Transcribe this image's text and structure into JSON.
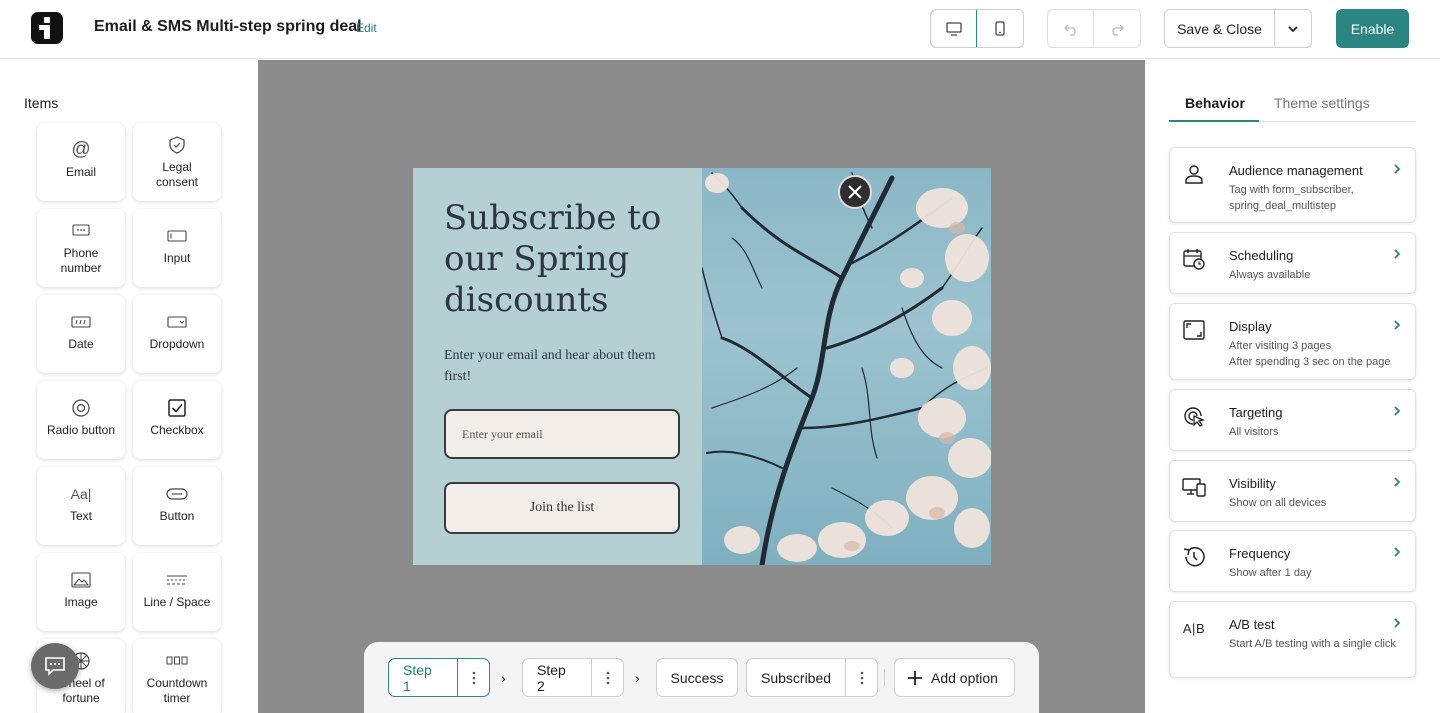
{
  "header": {
    "title": "Email & SMS Multi-step spring deal",
    "edit_label": "Edit",
    "save_label": "Save & Close",
    "enable_label": "Enable"
  },
  "sidebar": {
    "title": "Items",
    "items": [
      {
        "label": "Email",
        "icon": "at-icon"
      },
      {
        "label": "Legal\nconsent",
        "icon": "shield-icon"
      },
      {
        "label": "Phone\nnumber",
        "icon": "phone-icon"
      },
      {
        "label": "Input",
        "icon": "input-icon"
      },
      {
        "label": "Date",
        "icon": "date-icon"
      },
      {
        "label": "Dropdown",
        "icon": "dropdown-icon"
      },
      {
        "label": "Radio button",
        "icon": "radio-icon"
      },
      {
        "label": "Checkbox",
        "icon": "checkbox-icon"
      },
      {
        "label": "Text",
        "icon": "text-icon"
      },
      {
        "label": "Button",
        "icon": "button-icon"
      },
      {
        "label": "Image",
        "icon": "image-icon"
      },
      {
        "label": "Line / Space",
        "icon": "line-icon"
      },
      {
        "label": "Wheel of\nfortune",
        "icon": "wheel-icon"
      },
      {
        "label": "Countdown\ntimer",
        "icon": "timer-icon"
      }
    ]
  },
  "popup": {
    "heading": "Subscribe to our Spring discounts",
    "subtext": "Enter your email and hear about them first!",
    "email_placeholder": "Enter your email",
    "cta": "Join the list"
  },
  "steps": {
    "items": [
      {
        "label": "Step 1",
        "active": true,
        "has_menu": true
      },
      {
        "label": "Step 2",
        "active": false,
        "has_menu": true
      },
      {
        "label": "Success",
        "active": false,
        "has_menu": false
      },
      {
        "label": "Subscribed",
        "active": false,
        "has_menu": true
      }
    ],
    "add_label": "Add option"
  },
  "right_panel": {
    "tabs": [
      "Behavior",
      "Theme settings"
    ],
    "active_tab": "Behavior",
    "cards": [
      {
        "title": "Audience management",
        "desc": "Tag with form_subscriber, spring_deal_multistep",
        "icon": "user-icon"
      },
      {
        "title": "Scheduling",
        "desc": "Always available",
        "icon": "calendar-clock-icon"
      },
      {
        "title": "Display",
        "desc": "After visiting 3 pages\nAfter spending 3 sec on the page",
        "icon": "display-icon"
      },
      {
        "title": "Targeting",
        "desc": "All visitors",
        "icon": "target-icon"
      },
      {
        "title": "Visibility",
        "desc": "Show on all devices",
        "icon": "devices-icon"
      },
      {
        "title": "Frequency",
        "desc": "Show after 1 day",
        "icon": "history-icon"
      },
      {
        "title": "A/B test",
        "desc": "Start A/B testing with a single click",
        "icon": "ab-icon"
      }
    ]
  },
  "colors": {
    "accent": "#2a8583",
    "canvas_bg": "#8c8c8c",
    "popup_bg": "#b4d0d3"
  }
}
